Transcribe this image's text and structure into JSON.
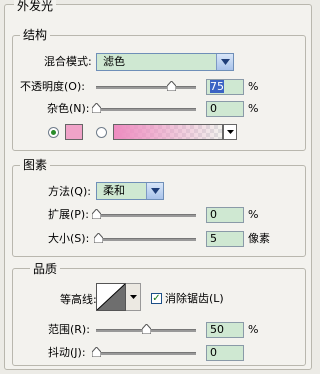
{
  "panel_title": "外发光",
  "structure": {
    "title": "结构",
    "blend_mode_label": "混合模式:",
    "blend_mode_value": "滤色",
    "opacity_label": "不透明度(O):",
    "opacity_value": "75",
    "opacity_unit": "%",
    "opacity_level": 0.75,
    "noise_label": "杂色(N):",
    "noise_value": "0",
    "noise_unit": "%",
    "noise_level": 0,
    "color_swatch": "#f0a3c8",
    "gradient_start": "#ee8cc0"
  },
  "elements": {
    "title": "图素",
    "method_label": "方法(Q):",
    "method_value": "柔和",
    "spread_label": "扩展(P):",
    "spread_value": "0",
    "spread_unit": "%",
    "spread_level": 0,
    "size_label": "大小(S):",
    "size_value": "5",
    "size_unit": "像素",
    "size_level": 0.02
  },
  "quality": {
    "title": "品质",
    "contour_label": "等高线:",
    "antialias_label": "消除锯齿(L)",
    "antialias_checked": true,
    "range_label": "范围(R):",
    "range_value": "50",
    "range_unit": "%",
    "range_level": 0.5,
    "jitter_label": "抖动(J):",
    "jitter_value": "0",
    "jitter_level": 0
  }
}
